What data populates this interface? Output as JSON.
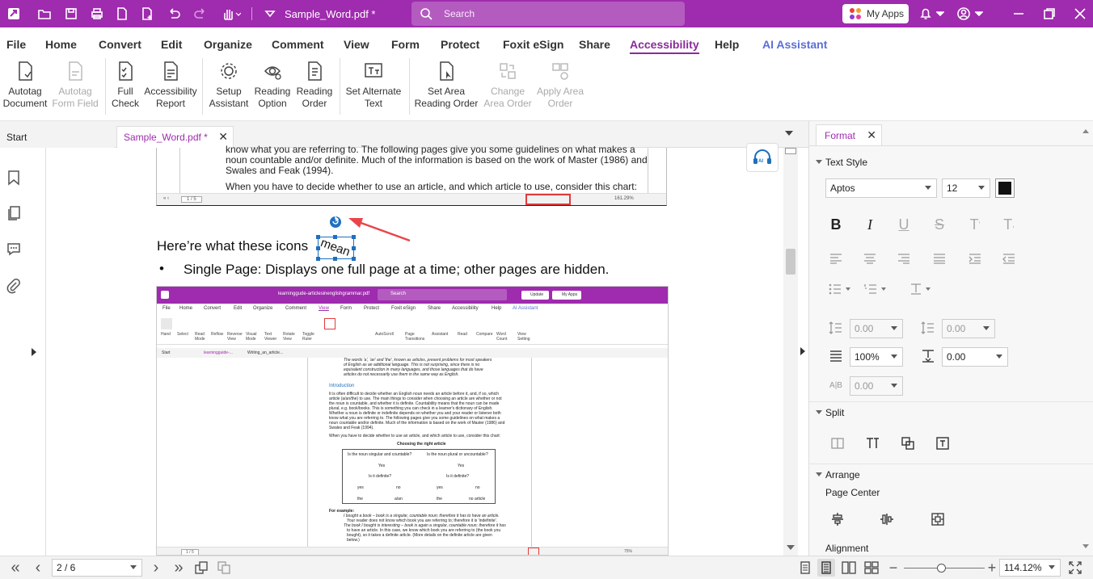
{
  "title_bar": {
    "doc_title": "Sample_Word.pdf *",
    "search_placeholder": "Search",
    "my_apps": "My Apps"
  },
  "menu": [
    "File",
    "Home",
    "Convert",
    "Edit",
    "Organize",
    "Comment",
    "View",
    "Form",
    "Protect",
    "Foxit eSign",
    "Share",
    "Accessibility",
    "Help",
    "AI Assistant"
  ],
  "menu_active": "Accessibility",
  "ribbon": {
    "autotag_document": [
      "Autotag",
      "Document"
    ],
    "autotag_form_field": [
      "Autotag",
      "Form Field"
    ],
    "full_check": [
      "Full",
      "Check"
    ],
    "accessibility_report": [
      "Accessibility",
      "Report"
    ],
    "setup_assistant": [
      "Setup",
      "Assistant"
    ],
    "reading_option": [
      "Reading",
      "Option"
    ],
    "reading_order": [
      "Reading",
      "Order"
    ],
    "set_alternate_text": [
      "Set Alternate",
      "Text"
    ],
    "set_area_reading_order": [
      "Set Area",
      "Reading Order"
    ],
    "change_area_order": [
      "Change",
      "Area Order"
    ],
    "apply_area_order": [
      "Apply Area",
      "Order"
    ]
  },
  "tabs": {
    "start": "Start",
    "doc": "Sample_Word.pdf *"
  },
  "document": {
    "top_para": [
      "know what you are referring to. The following pages give you some guidelines on what makes a",
      "noun countable and/or definite. Much of the information is based on the work of Master (1986) and",
      "Swales and Feak (1994)."
    ],
    "top_question": "When you have to decide whether to use an article, and which article to use, consider this chart:",
    "mini_page": "1 / 5",
    "mini_zoom": "161.29%",
    "heading_line": "Here’re what these icons",
    "rotated_text": "mean",
    "bullet": "Single Page: Displays one full page at a time; other pages are hidden."
  },
  "embedded": {
    "title": "learninggude-articlesinenglishgrammar.pdf",
    "search": "Search",
    "update": "Update",
    "my_apps": "My Apps",
    "menu": [
      "File",
      "Home",
      "Convert",
      "Edit",
      "Organize",
      "Comment",
      "View",
      "Form",
      "Protect",
      "Foxit eSign",
      "Share",
      "Accessibility",
      "Help",
      "AI Assistant"
    ],
    "tools": [
      "Hand",
      "Select",
      "Read Mode",
      "Reflow",
      "Reverse View",
      "Visual Mode",
      "Text Viewer",
      "Rotate View",
      "Toggle Ruler",
      "AutoScroll",
      "Page Transitions",
      "Assistant",
      "Read",
      "Compare",
      "Word Count",
      "View Setting"
    ],
    "tabs": [
      "Start",
      "learningguide-...",
      "Writing_an_article..."
    ],
    "intro_lines": [
      "The words 'a', 'an' and 'the', known as articles, present problems for most speakers",
      "of English as an additional language. This is not surprising, since there is no",
      "equivalent construction in many languages, and those languages that do have",
      "articles do not necessarily use them in the same way as English."
    ],
    "section": "Introduction",
    "body_lines": [
      "It is often difficult to decide whether an English noun needs an article before it, and, if so, which",
      "article (a/an/the) to use. The main things to consider when choosing an article are whether or not",
      "the noun is countable, and whether it is definite. Countability means that the noun can be made",
      "plural, e.g. book/books. This is something you can check in a learner's dictionary of English.",
      "Whether a noun is definite or indefinite depends on whether you and your reader or listener both",
      "know what you are referring to. The following pages give you some guidelines on what makes a",
      "noun countable and/or definite. Much of the information is based on the work of Master (1986) and",
      "Swales and Feak (1994)."
    ],
    "chart_q": "When you have to decide whether to use an article, and which article to use, consider this chart:",
    "chart_title": "Choosing the right article",
    "tree_left": "Is the noun singular and countable?",
    "tree_right": "Is the noun plural or uncountable?",
    "yes": "Yes",
    "definite": "Is it definite?",
    "yes2": "yes",
    "no": "no",
    "the": "the",
    "aan": "a/an",
    "no_article": "no article",
    "example_h": "For example:",
    "example_lines": [
      "I bought a book – book is a singular, countable noun; therefore it has to have an article.",
      "Your reader does not know which book you are referring to; therefore it is 'indefinite'.",
      "The book I bought is interesting – book is again a singular, countable noun; therefore it has",
      "to have an article. In this case, we know which book you are referring to (the book you",
      "bought), so it takes a definite article. (More details on the definite article are given",
      "below.)"
    ],
    "page": "1 / 5",
    "zoom": "75%"
  },
  "right_panel": {
    "tab": "Format",
    "text_style": "Text Style",
    "font": "Aptos",
    "font_size": "12",
    "font_color": "#111111",
    "char_spacing": "0.00",
    "word_spacing": "0.00",
    "line_spacing": "100%",
    "para_spacing": "0.00",
    "scale": "0.00",
    "split": "Split",
    "arrange": "Arrange",
    "page_center": "Page Center",
    "alignment": "Alignment"
  },
  "status": {
    "page": "2 / 6",
    "zoom": "114.12%"
  },
  "colors": {
    "brand": "#9f2bae",
    "accent_blue": "#1f6fbf",
    "highlight_red": "#e03b3b"
  }
}
